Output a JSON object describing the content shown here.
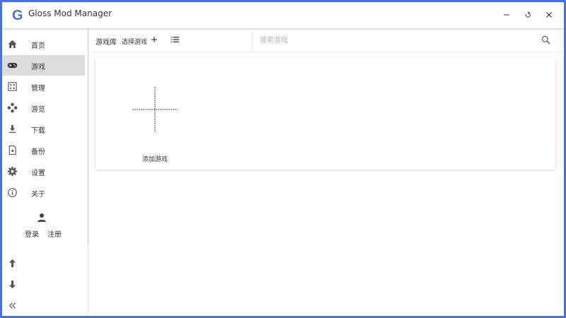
{
  "window": {
    "title": "Gloss Mod Manager",
    "accent_color": "#4a72d6",
    "logo_letter": "G"
  },
  "sidebar": {
    "items": [
      {
        "label": "首页",
        "icon": "home-icon",
        "active": false
      },
      {
        "label": "游戏",
        "icon": "gamepad-icon",
        "active": true
      },
      {
        "label": "管理",
        "icon": "grid-icon",
        "active": false
      },
      {
        "label": "游览",
        "icon": "browse-icon",
        "active": false
      },
      {
        "label": "下载",
        "icon": "download-icon",
        "active": false
      },
      {
        "label": "备份",
        "icon": "backup-icon",
        "active": false
      },
      {
        "label": "设置",
        "icon": "gear-icon",
        "active": false
      },
      {
        "label": "关于",
        "icon": "info-icon",
        "active": false
      }
    ],
    "login_label": "登录",
    "register_label": "注册"
  },
  "toolbar": {
    "library_title": "游戏库",
    "select_game_label": "选择游戏",
    "search_placeholder": "搜索游戏"
  },
  "content": {
    "add_game_label": "添加游戏"
  }
}
